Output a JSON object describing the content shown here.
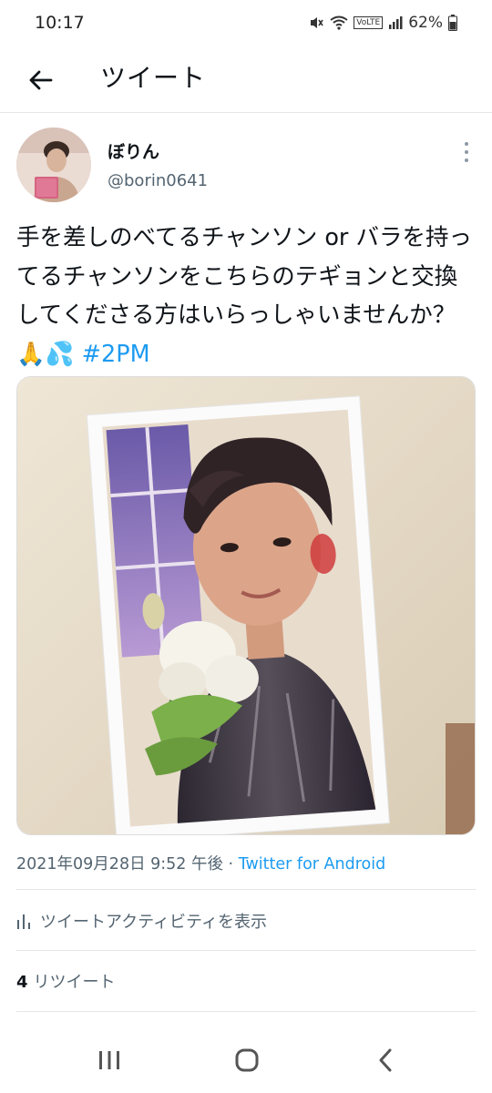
{
  "status_bar": {
    "time": "10:17",
    "battery": "62%",
    "network_label": "VoLTE"
  },
  "header": {
    "title": "ツイート"
  },
  "author": {
    "name": "ぼりん",
    "handle": "@borin0641"
  },
  "tweet": {
    "text": "手を差しのべてるチャンソン or バラを持ってるチャンソンをこちらのテギョンと交換してくださる方はいらっしゃいませんか？🙏💦 ",
    "hashtag": "#2PM",
    "timestamp": "2021年09月28日 9:52 午後 · ",
    "source": "Twitter for Android"
  },
  "activity": {
    "label": "ツイートアクティビティを表示"
  },
  "stats": {
    "retweet_count": "4",
    "retweet_label": "リツイート"
  },
  "colors": {
    "accent": "#1d9bf0",
    "secondary_text": "#536471",
    "divider": "#e6e6e6"
  },
  "icons": {
    "back": "arrow-left-icon",
    "more": "more-vertical-icon",
    "activity": "bar-chart-icon",
    "nav_recents": "recents-icon",
    "nav_home": "home-icon",
    "nav_back": "back-chevron-icon"
  }
}
